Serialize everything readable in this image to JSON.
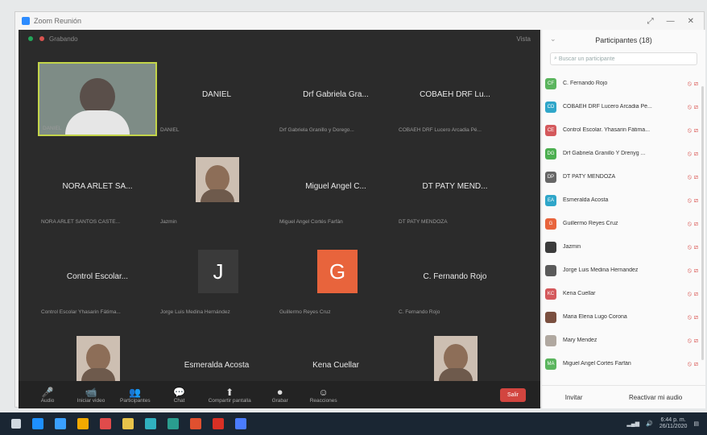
{
  "window": {
    "title": "Zoom Reunión",
    "controls": [
      "⤢",
      "—",
      "✕"
    ]
  },
  "meeting": {
    "recording": "Grabando",
    "view_label": "Vista"
  },
  "tiles": [
    {
      "name": "",
      "label": "DANIEL",
      "kind": "video"
    },
    {
      "name": "DANIEL",
      "label": "DANIEL",
      "kind": "name"
    },
    {
      "name": "Drf Gabriela Gra...",
      "label": "Drf Gabriela Granillo y Dorego...",
      "kind": "name"
    },
    {
      "name": "COBAEH DRF Lu...",
      "label": "COBAEH DRF Lucero Arcadia Pé...",
      "kind": "name"
    },
    {
      "name": "NORA ARLET SA...",
      "label": "NORA ARLET SANTOS CASTE...",
      "kind": "name"
    },
    {
      "name": "",
      "label": "Jazmin",
      "kind": "portrait"
    },
    {
      "name": "Miguel Angel C...",
      "label": "Miguel Angel Cortés Farfán",
      "kind": "name"
    },
    {
      "name": "DT PATY MEND...",
      "label": "DT PATY MENDOZA",
      "kind": "name"
    },
    {
      "name": "Control Escolar...",
      "label": "Control Escolar Yhasarin Fátima...",
      "kind": "name"
    },
    {
      "name": "J",
      "label": "Jorge Luis Medina Hernández",
      "kind": "letter",
      "color": "#3a3a3a"
    },
    {
      "name": "G",
      "label": "Guillermo Reyes Cruz",
      "kind": "letter",
      "color": "#e8643c"
    },
    {
      "name": "C. Fernando Rojo",
      "label": "C. Fernando Rojo",
      "kind": "name"
    },
    {
      "name": "",
      "label": "Maria Elena Lugo Corona",
      "kind": "portrait"
    },
    {
      "name": "Esmeralda Acosta",
      "label": "Esmeralda Acosta",
      "kind": "name"
    },
    {
      "name": "Kena Cuellar",
      "label": "Kena Cuéllar",
      "kind": "name"
    },
    {
      "name": "",
      "label": "Mary Mendez",
      "kind": "portrait"
    }
  ],
  "toolbar": {
    "buttons": [
      {
        "icon": "🎤",
        "label": "Audio"
      },
      {
        "icon": "📹",
        "label": "Iniciar video"
      },
      {
        "icon": "👥",
        "label": "Participantes"
      },
      {
        "icon": "💬",
        "label": "Chat"
      },
      {
        "icon": "⬆",
        "label": "Compartir pantalla"
      },
      {
        "icon": "⏺",
        "label": "Grabar"
      },
      {
        "icon": "☺",
        "label": "Reacciones"
      }
    ],
    "end_label": "Salir"
  },
  "panel": {
    "title": "Participantes (18)",
    "search_placeholder": "Buscar un participante",
    "participants": [
      {
        "initials": "CF",
        "name": "C. Fernando Rojo",
        "color": "#5bb55e"
      },
      {
        "initials": "CD",
        "name": "COBAEH DRF Lucero Arcadia Pé...",
        "color": "#2fa6c9"
      },
      {
        "initials": "CE",
        "name": "Control Escolar. Yhasarin Fátima...",
        "color": "#d4595c"
      },
      {
        "initials": "DG",
        "name": "Drf Gabriela Granillo Y Drenyg ...",
        "color": "#4caf50"
      },
      {
        "initials": "DP",
        "name": "DT PATY MENDOZA",
        "color": "#666666"
      },
      {
        "initials": "EA",
        "name": "Esmeralda Acosta",
        "color": "#2fa6c9"
      },
      {
        "initials": "G",
        "name": "Guillermo Reyes Cruz",
        "color": "#e8643c"
      },
      {
        "initials": "",
        "name": "Jazmin",
        "color": "#3b3b3b"
      },
      {
        "initials": "",
        "name": "Jorge Luis Medina Hernandez",
        "color": "#5a5a5a"
      },
      {
        "initials": "KC",
        "name": "Kena Cuellar",
        "color": "#d4595c"
      },
      {
        "initials": "",
        "name": "Maria Elena Lugo Corona",
        "color": "#7a4f3f"
      },
      {
        "initials": "",
        "name": "Mary Mendez",
        "color": "#b0a8a0"
      },
      {
        "initials": "MA",
        "name": "Miguel Angel Cortés Farfán",
        "color": "#5bb55e"
      }
    ],
    "invite_label": "Invitar",
    "unmute_label": "Reactivar mi audio"
  },
  "taskbar": {
    "time": "6:44 p. m.",
    "date": "26/11/2020",
    "apps": [
      "#1e90ff",
      "#3aa0ff",
      "#f2a900",
      "#e04b4b",
      "#e8c34a",
      "#30b0c0",
      "#2a9d8f",
      "#e0502f",
      "#d93025",
      "#4a7cff"
    ]
  }
}
